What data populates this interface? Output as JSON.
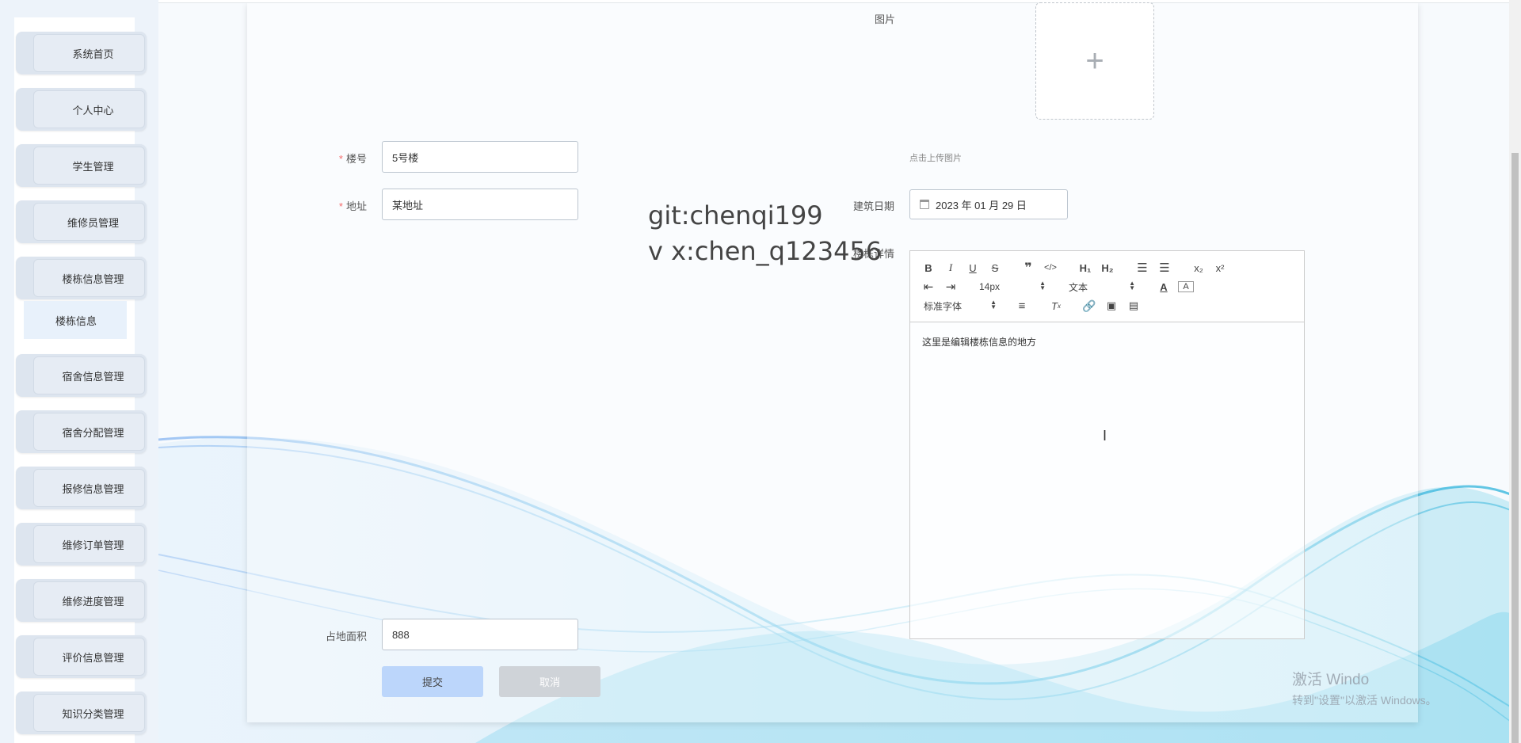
{
  "sidebar": {
    "items": [
      {
        "label": "系统首页"
      },
      {
        "label": "个人中心"
      },
      {
        "label": "学生管理"
      },
      {
        "label": "维修员管理"
      },
      {
        "label": "楼栋信息管理"
      },
      {
        "label": "宿舍信息管理"
      },
      {
        "label": "宿舍分配管理"
      },
      {
        "label": "报修信息管理"
      },
      {
        "label": "维修订单管理"
      },
      {
        "label": "维修进度管理"
      },
      {
        "label": "评价信息管理"
      },
      {
        "label": "知识分类管理"
      }
    ],
    "submenu": {
      "label": "楼栋信息"
    }
  },
  "form": {
    "image": {
      "label": "图片",
      "upload_hint": "点击上传图片",
      "plus_icon": "plus-icon"
    },
    "building_no": {
      "label": "楼号",
      "value": "5号楼",
      "required": true
    },
    "address": {
      "label": "地址",
      "value": "某地址",
      "required": true
    },
    "build_date": {
      "label": "建筑日期",
      "value": "2023 年 01 月 29 日"
    },
    "details": {
      "label": "楼栋详情",
      "content": "这里是编辑楼栋信息的地方",
      "font_size": "14px",
      "text_type": "文本",
      "font_family": "标准字体"
    },
    "area": {
      "label": "占地面积",
      "value": "888"
    },
    "submit_label": "提交",
    "cancel_label": "取消"
  },
  "watermark": {
    "line1": "git:chenqi199",
    "line2": "v x:chen_q123456"
  },
  "windows_activation": {
    "line1": "激活 Windo",
    "line2": "转到\"设置\"以激活 Windows。"
  },
  "colors": {
    "primary_button": "#bcd6fb",
    "cancel_button": "#cfd3d8",
    "required_star": "#f56c6c"
  }
}
